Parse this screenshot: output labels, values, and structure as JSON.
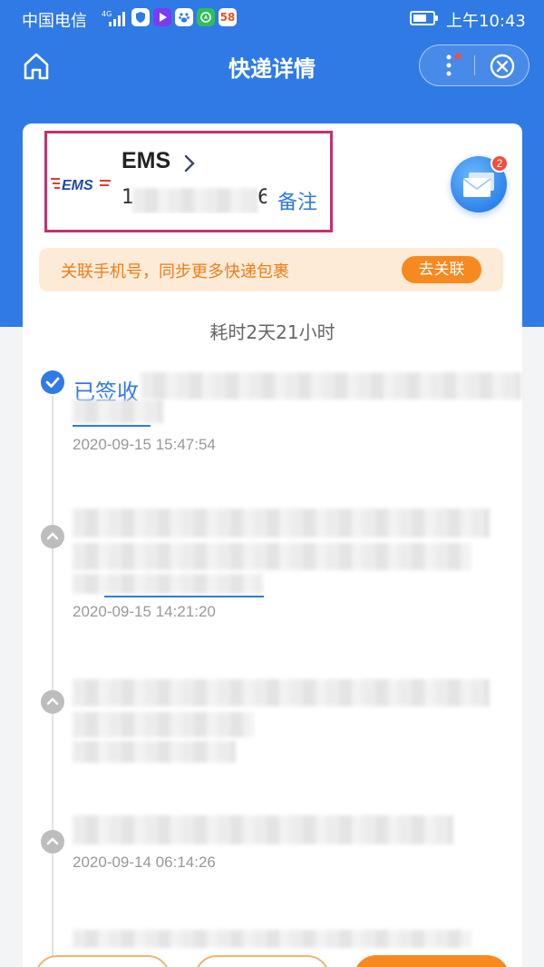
{
  "status_bar": {
    "carrier": "中国电信",
    "network": "4G",
    "time": "上午10:43",
    "battery_level": 0.7,
    "app_icons": [
      "shield-icon",
      "video-app-icon",
      "baidu-icon",
      "compass-app-icon",
      "58-app-icon"
    ],
    "app_58_label": "58"
  },
  "nav": {
    "title": "快递详情"
  },
  "courier": {
    "name": "EMS",
    "logo_text": "EMS",
    "tracking_prefix": "1",
    "tracking_suffix": "6",
    "remark_label": "备注",
    "message_badge": "2"
  },
  "banner": {
    "text": "关联手机号，同步更多快递包裹",
    "button_label": "去关联"
  },
  "duration": "耗时2天21小时",
  "timeline": [
    {
      "status": "已签收",
      "time": "2020-09-15 15:47:54",
      "state": "delivered"
    },
    {
      "status": "",
      "time": "2020-09-15 14:21:20",
      "state": "in-transit"
    },
    {
      "status": "",
      "time": "",
      "state": "in-transit"
    },
    {
      "status": "",
      "time": "2020-09-14 06:14:26",
      "state": "in-transit"
    }
  ],
  "colors": {
    "brand_blue": "#2f7ae5",
    "highlight_border": "#c5306d",
    "banner_bg": "#fdebd8",
    "banner_text": "#ef7d1a",
    "cta_orange": "#f7891f"
  }
}
